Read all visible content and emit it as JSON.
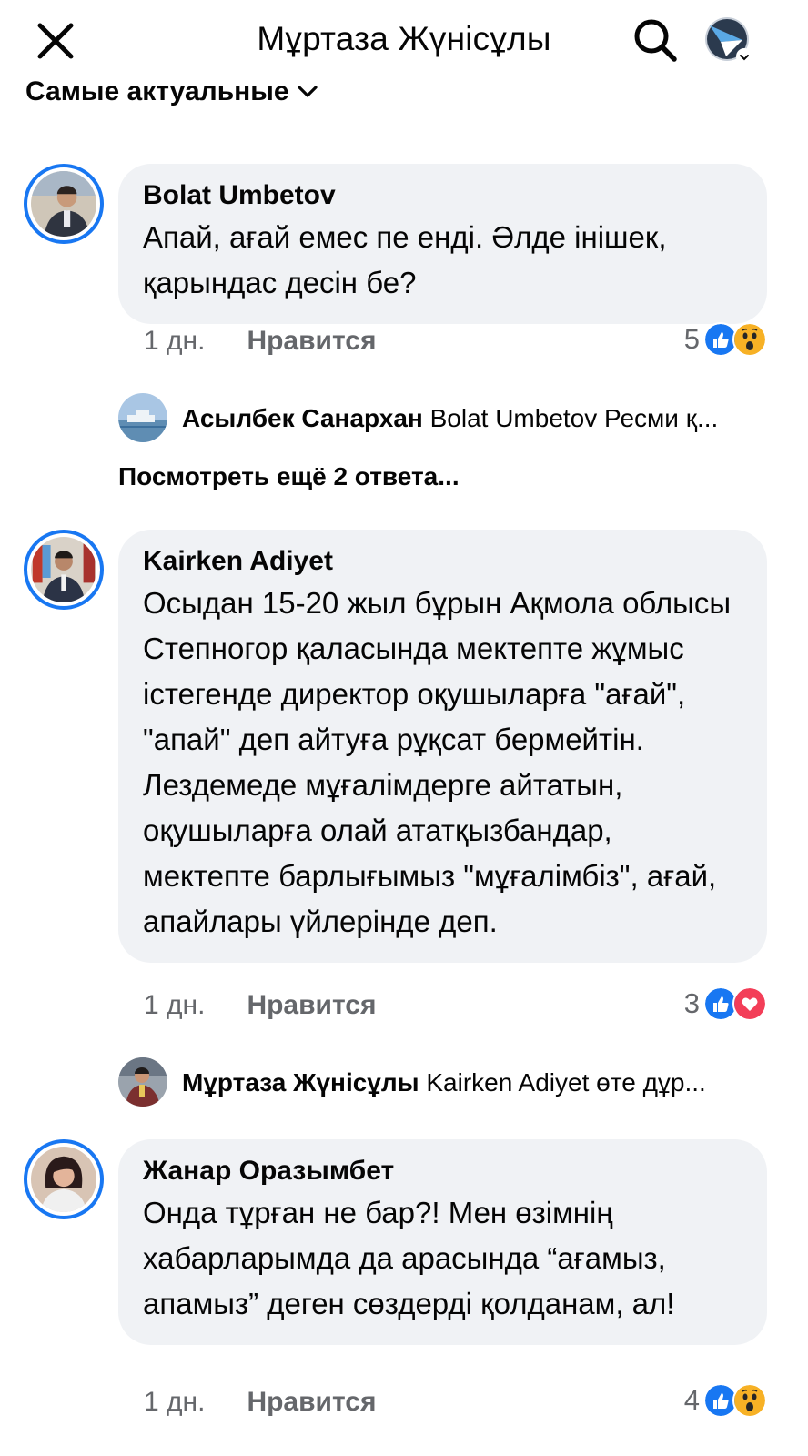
{
  "header": {
    "title": "Мұртаза Жүнісұлы"
  },
  "sort": {
    "label": "Самые актуальные"
  },
  "comments": [
    {
      "author": "Bolat Umbetov",
      "text": "Апай, ағай емес пе енді. Әлде інішек, қарындас десін бе?",
      "time": "1 дн.",
      "like_label": "Нравится",
      "reaction_count": "5",
      "reactions": [
        "like",
        "wow"
      ]
    },
    {
      "author": "Kairken Adiyet",
      "text": "Осыдан 15-20 жыл бұрын Ақмола облысы Степногор қаласында мектепте жұмыс істегенде директор оқушыларға \"ағай\", \"апай\" деп айтуға рұқсат бермейтін. Лездемеде мұғалімдерге айтатын, оқушыларға олай ататқызбандар, мектепте барлығымыз \"мұғалімбіз\", ағай, апайлары үйлерінде деп.",
      "time": "1 дн.",
      "like_label": "Нравится",
      "reaction_count": "3",
      "reactions": [
        "like",
        "love"
      ]
    },
    {
      "author": "Жанар Оразымбет",
      "text": "Онда тұрған не бар?! Мен өзімнің хабарларымда да арасында “ағамыз, апамыз” деген сөздерді қолданам, ал!",
      "time": "1 дн.",
      "like_label": "Нравится",
      "reaction_count": "4",
      "reactions": [
        "like",
        "wow"
      ]
    }
  ],
  "replies": [
    {
      "name": "Асылбек Санархан",
      "text": "Bolat Umbetov Ресми қ..."
    },
    {
      "name": "Мұртаза Жүнісұлы",
      "text": "Kairken Adiyet өте дұр..."
    }
  ],
  "more_replies": "Посмотреть ещё 2 ответа...",
  "colors": {
    "accent": "#1877f2",
    "bubble": "#f0f2f5",
    "meta": "#65676b",
    "love": "#f33e58",
    "wow": "#f7b125"
  },
  "icons": [
    "close-icon",
    "search-icon",
    "chevron-down-icon",
    "like-reaction-icon",
    "wow-reaction-icon",
    "love-reaction-icon"
  ]
}
